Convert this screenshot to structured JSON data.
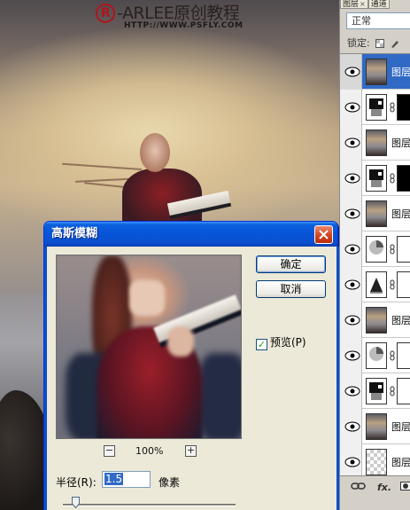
{
  "watermark": {
    "reg_symbol": "R",
    "title": "-ARLEE原创教程",
    "url": "HTTP://WWW.PSFLY.COM"
  },
  "layers_panel": {
    "tabs": [
      {
        "label": "图层"
      },
      {
        "label": "通道"
      }
    ],
    "blend_mode": "正常",
    "lock_label": "锁定:",
    "layer_name": "图层",
    "bottom_icons": [
      "link-icon",
      "fx-icon",
      "mask-icon"
    ],
    "fx_label": "fx."
  },
  "dialog": {
    "title": "高斯模糊",
    "ok_label": "确定",
    "cancel_label": "取消",
    "preview_label": "预览(P)",
    "preview_checked": true,
    "zoom_minus": "−",
    "zoom_plus": "+",
    "zoom_level": "100%",
    "radius_label": "半径(R):",
    "radius_value": "1.5",
    "radius_unit": "像素"
  },
  "colors": {
    "titlebar": "#0a4fce",
    "selected_layer": "#316ac5",
    "close_button": "#d3431f"
  }
}
